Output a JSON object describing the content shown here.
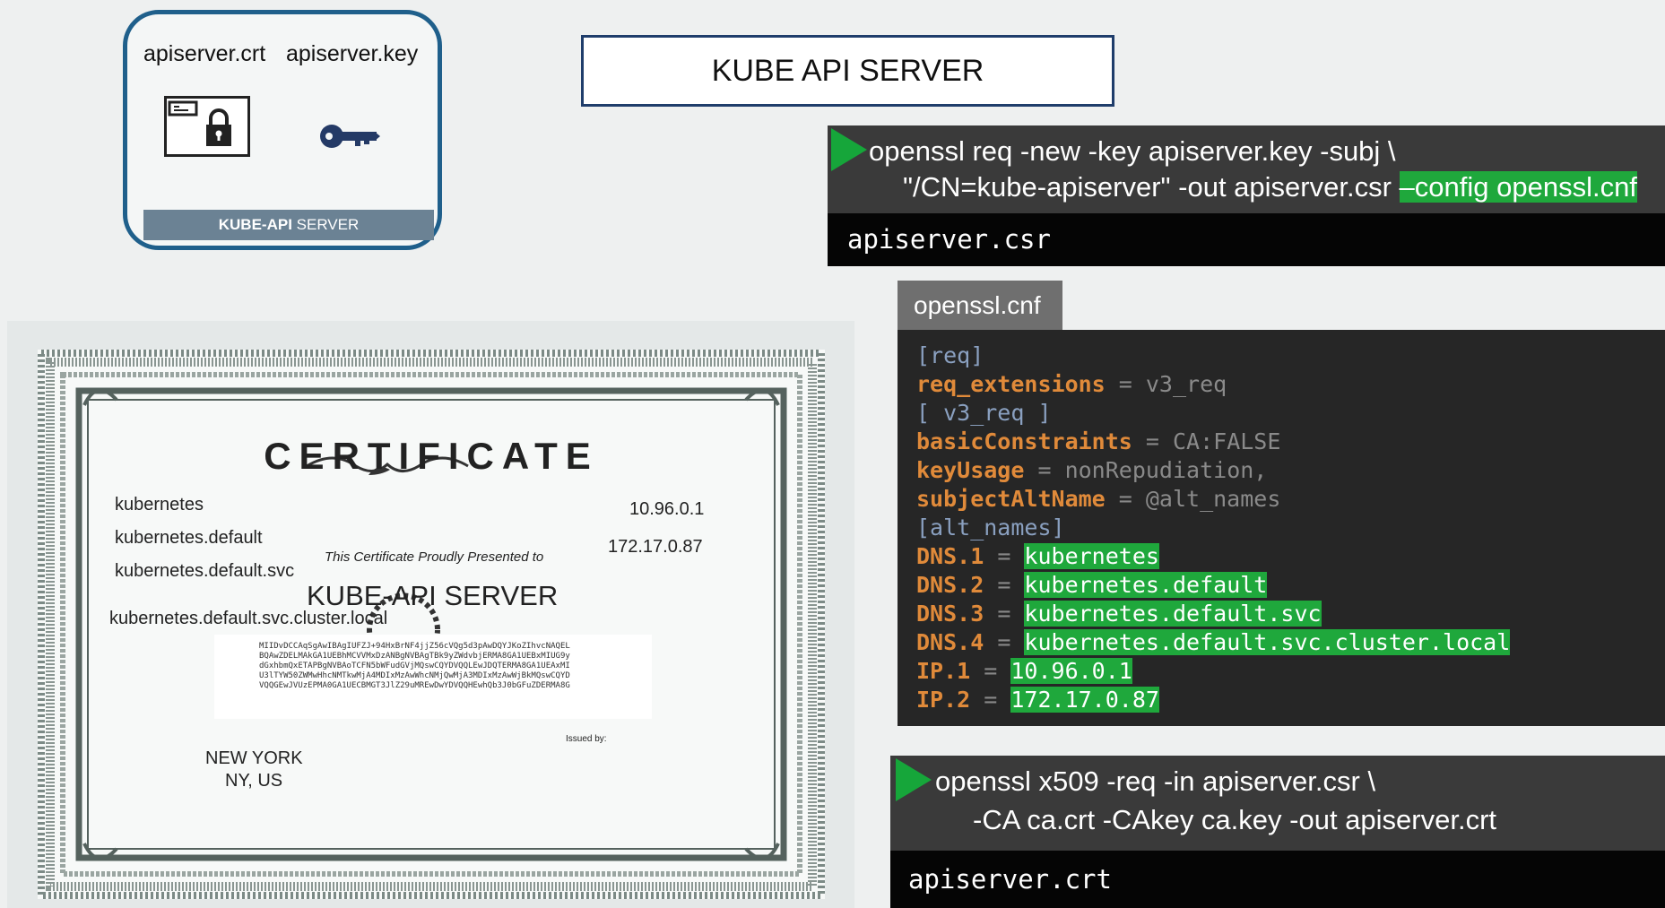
{
  "key_card": {
    "crt_file": "apiserver.crt",
    "key_file": "apiserver.key",
    "banner_bold": "KUBE-API",
    "banner_rest": " SERVER"
  },
  "title": "KUBE API SERVER",
  "csr_command": {
    "line1": "openssl req -new -key apiserver.key -subj \\",
    "line2_plain": "\"/CN=kube-apiserver\" -out apiserver.csr ",
    "line2_highlight": "–config openssl.cnf",
    "output": "apiserver.csr"
  },
  "openssl_cnf": {
    "tab_label": "openssl.cnf",
    "lines": [
      {
        "a": "[req]"
      },
      {
        "k": "req_extensions",
        "e": " = ",
        "v": "v3_req"
      },
      {
        "a": "[ v3_req ]"
      },
      {
        "k": "basicConstraints",
        "e": " = ",
        "v": "CA:FALSE"
      },
      {
        "k": "keyUsage",
        "e": " = ",
        "v": "nonRepudiation,"
      },
      {
        "k": "subjectAltName",
        "e": " = ",
        "v": "@alt_names"
      },
      {
        "a": "[alt_names]"
      }
    ],
    "alt_names": [
      {
        "k": "DNS.1",
        "v": "kubernetes"
      },
      {
        "k": "DNS.2",
        "v": "kubernetes.default"
      },
      {
        "k": "DNS.3",
        "v": "kubernetes.default.svc"
      },
      {
        "k": "DNS.4",
        "v": "kubernetes.default.svc.cluster.local"
      },
      {
        "k": "IP.1",
        "v": "10.96.0.1"
      },
      {
        "k": "IP.2",
        "v": "172.17.0.87"
      }
    ]
  },
  "sign_command": {
    "line1": "openssl x509 -req -in apiserver.csr \\",
    "line2": "-CA ca.crt -CAkey ca.key -out apiserver.crt",
    "output": "apiserver.crt"
  },
  "certificate": {
    "heading": "CERTIFICATE",
    "dns_names": [
      "kubernetes",
      "kubernetes.default",
      "kubernetes.default.svc",
      "kubernetes.default.svc.cluster.local"
    ],
    "ips": [
      "10.96.0.1",
      "172.17.0.87"
    ],
    "presented_to": "This Certificate Proudly Presented to",
    "name": "KUBE-API SERVER",
    "hash": "MIIDvDCCAqSgAwIBAgIUFZJ+94HxBrNF4jjZ56cVQg5d3pAwDQYJKoZIhvcNAQEL\nBQAwZDELMAkGA1UEBhMCVVMxDzANBgNVBAgTBk9yZWdvbjERMA8GA1UEBxMIUG9y\ndGxhbmQxETAPBgNVBAoTCFN5bWFudGVjMQswCQYDVQQLEwJDQTERMA8GA1UEAxMI\nU3lTYW50ZWMwHhcNMTkwMjA4MDIxMzAwWhcNMjQwMjA3MDIxMzAwWjBkMQswCQYD\nVQQGEwJVUzEPMA0GA1UECBMGT3JlZ29uMREwDwYDVQQHEwhQb3J0bGFuZDERMA8G",
    "location_line1": "NEW YORK",
    "location_line2": "NY, US",
    "issued_by": "Issued by:"
  }
}
